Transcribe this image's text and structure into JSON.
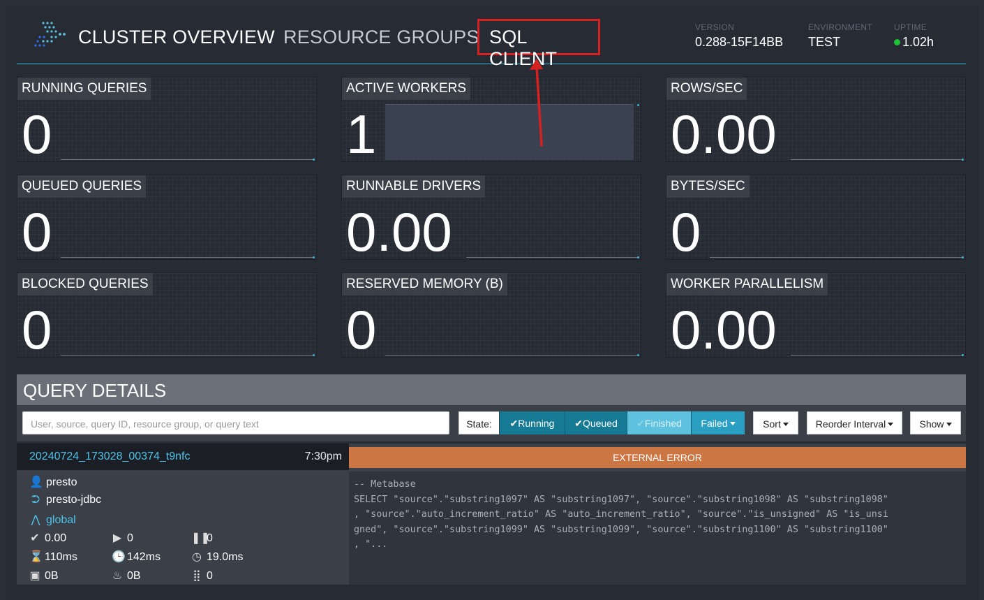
{
  "header": {
    "nav": {
      "cluster_overview": "CLUSTER OVERVIEW",
      "resource_groups": "RESOURCE GROUPS",
      "sql_client": "SQL CLIENT"
    },
    "version_label": "VERSION",
    "version": "0.288-15F14BB",
    "environment_label": "ENVIRONMENT",
    "environment": "TEST",
    "uptime_label": "UPTIME",
    "uptime": "1.02h",
    "uptime_status_color": "#1fc33a",
    "accent_color": "#3fb4d6",
    "highlight_color": "#d72020"
  },
  "stats": {
    "running_queries": {
      "label": "RUNNING QUERIES",
      "value": "0"
    },
    "active_workers": {
      "label": "ACTIVE WORKERS",
      "value": "1"
    },
    "rows_sec": {
      "label": "ROWS/SEC",
      "value": "0.00"
    },
    "queued_queries": {
      "label": "QUEUED QUERIES",
      "value": "0"
    },
    "runnable_drivers": {
      "label": "RUNNABLE DRIVERS",
      "value": "0.00"
    },
    "bytes_sec": {
      "label": "BYTES/SEC",
      "value": "0"
    },
    "blocked_queries": {
      "label": "BLOCKED QUERIES",
      "value": "0"
    },
    "reserved_memory": {
      "label": "RESERVED MEMORY (B)",
      "value": "0"
    },
    "worker_parallelism": {
      "label": "WORKER PARALLELISM",
      "value": "0.00"
    }
  },
  "query_details": {
    "title": "QUERY DETAILS",
    "search_placeholder": "User, source, query ID, resource group, or query text",
    "state_label": "State:",
    "filters": {
      "running": "Running",
      "queued": "Queued",
      "finished": "Finished",
      "failed": "Failed"
    },
    "sort_label": "Sort",
    "reorder_label": "Reorder Interval",
    "show_label": "Show"
  },
  "query": {
    "id": "20240724_173028_00374_t9nfc",
    "time": "7:30pm",
    "state": "EXTERNAL ERROR",
    "state_color": "#cc7743",
    "user": "presto",
    "source": "presto-jdbc",
    "resource_group": "global",
    "stats": {
      "completed_splits": "0.00",
      "running_splits": "0",
      "queued_splits": "0",
      "wall_time": "110ms",
      "elapsed_time": "142ms",
      "cpu_time": "19.0ms",
      "memory": "0B",
      "peak_memory": "0B",
      "cumulative": "0"
    },
    "sql_text": "-- Metabase\nSELECT \"source\".\"substring1097\" AS \"substring1097\", \"source\".\"substring1098\" AS \"substring1098\"\n, \"source\".\"auto_increment_ratio\" AS \"auto_increment_ratio\", \"source\".\"is_unsigned\" AS \"is_unsi\ngned\", \"source\".\"substring1099\" AS \"substring1099\", \"source\".\"substring1100\" AS \"substring1100\"\n, \"..."
  }
}
